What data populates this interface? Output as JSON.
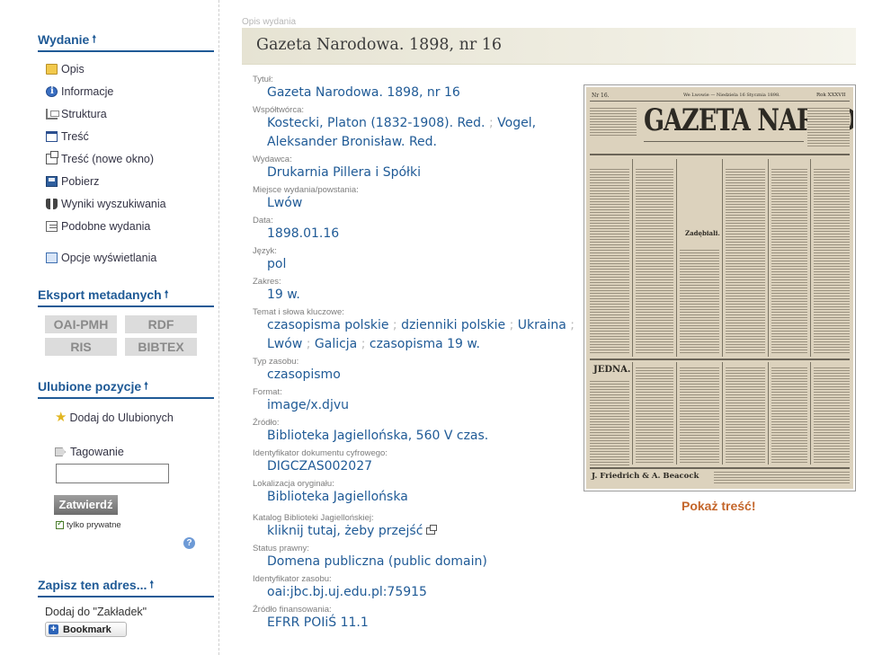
{
  "sidebar": {
    "wydanie": {
      "heading": "Wydanie",
      "items": [
        {
          "label": "Opis",
          "icon": "description-icon"
        },
        {
          "label": "Informacje",
          "icon": "info-icon"
        },
        {
          "label": "Struktura",
          "icon": "structure-icon"
        },
        {
          "label": "Treść",
          "icon": "book-icon"
        },
        {
          "label": "Treść (nowe okno)",
          "icon": "new-window-icon"
        },
        {
          "label": "Pobierz",
          "icon": "save-icon"
        },
        {
          "label": "Wyniki wyszukiwania",
          "icon": "binoculars-icon"
        },
        {
          "label": "Podobne wydania",
          "icon": "documents-icon"
        },
        {
          "label": "Opcje wyświetlania",
          "icon": "display-options-icon"
        }
      ]
    },
    "export": {
      "heading": "Eksport metadanych",
      "buttons": [
        "OAI-PMH",
        "RDF",
        "RIS",
        "BIBTEX"
      ]
    },
    "favorites": {
      "heading": "Ulubione pozycje",
      "add_label": "Dodaj do Ulubionych",
      "tag_label": "Tagowanie",
      "tag_value": "",
      "submit_label": "Zatwierdź",
      "private_label": "tylko prywatne",
      "help_glyph": "?"
    },
    "save_address": {
      "heading": "Zapisz ten adres...",
      "bookmark_text": "Dodaj do \"Zakładek\"",
      "bookmark_button": "Bookmark"
    }
  },
  "main": {
    "breadcrumb": "Opis wydania",
    "title": "Gazeta Narodowa. 1898, nr 16",
    "fields": {
      "tytul": {
        "label": "Tytuł:",
        "value": "Gazeta Narodowa. 1898, nr 16"
      },
      "wspoltworca": {
        "label": "Współtwórca:",
        "values": [
          "Kostecki, Platon (1832-1908). Red.",
          "Vogel, Aleksander Bronisław. Red."
        ]
      },
      "wydawca": {
        "label": "Wydawca:",
        "value": "Drukarnia Pillera i Spółki"
      },
      "miejsce": {
        "label": "Miejsce wydania/powstania:",
        "value": "Lwów"
      },
      "data": {
        "label": "Data:",
        "value": "1898.01.16"
      },
      "jezyk": {
        "label": "Język:",
        "value": "pol"
      },
      "zakres": {
        "label": "Zakres:",
        "value": "19 w."
      },
      "temat": {
        "label": "Temat i słowa kluczowe:",
        "values": [
          "czasopisma polskie",
          "dzienniki polskie",
          "Ukraina",
          "Lwów",
          "Galicja",
          "czasopisma 19 w."
        ]
      },
      "typ": {
        "label": "Typ zasobu:",
        "value": "czasopismo"
      },
      "format": {
        "label": "Format:",
        "value": "image/x.djvu"
      },
      "zrodlo": {
        "label": "Źródło:",
        "value": "Biblioteka Jagiellońska, 560 V czas."
      },
      "identyfikator": {
        "label": "Identyfikator dokumentu cyfrowego:",
        "value": "DIGCZAS002027"
      },
      "lokalizacja": {
        "label": "Lokalizacja oryginału:",
        "value": "Biblioteka Jagiellońska"
      },
      "katalog": {
        "label": "Katalog Biblioteki Jagiellońskiej:",
        "value": "kliknij tutaj, żeby przejść"
      },
      "status": {
        "label": "Status prawny:",
        "value": "Domena publiczna (public domain)"
      },
      "id_zasobu": {
        "label": "Identyfikator zasobu:",
        "value": "oai:jbc.bj.uj.edu.pl:75915"
      },
      "finansowanie": {
        "label": "Źródło finansowania:",
        "value": "EFRR POIiŚ 11.1"
      }
    },
    "thumbnail": {
      "masthead": "GAZETA NARODOWA",
      "number": "Nr 16.",
      "dateline": "We Lwowie — Niedziela 16 Stycznia 1898.",
      "year": "Rok XXXVII",
      "section": "Zadębiali.",
      "notice": "JEDNA.",
      "footer": "J. Friedrich & A. Beacock"
    },
    "show_content": "Pokaż treść!"
  },
  "colors": {
    "heading": "#1f5a96",
    "value_text": "#1f5a96",
    "label_text": "#7d7d7d",
    "title_bar": "#ece9dc",
    "show_content": "#c4662b"
  }
}
